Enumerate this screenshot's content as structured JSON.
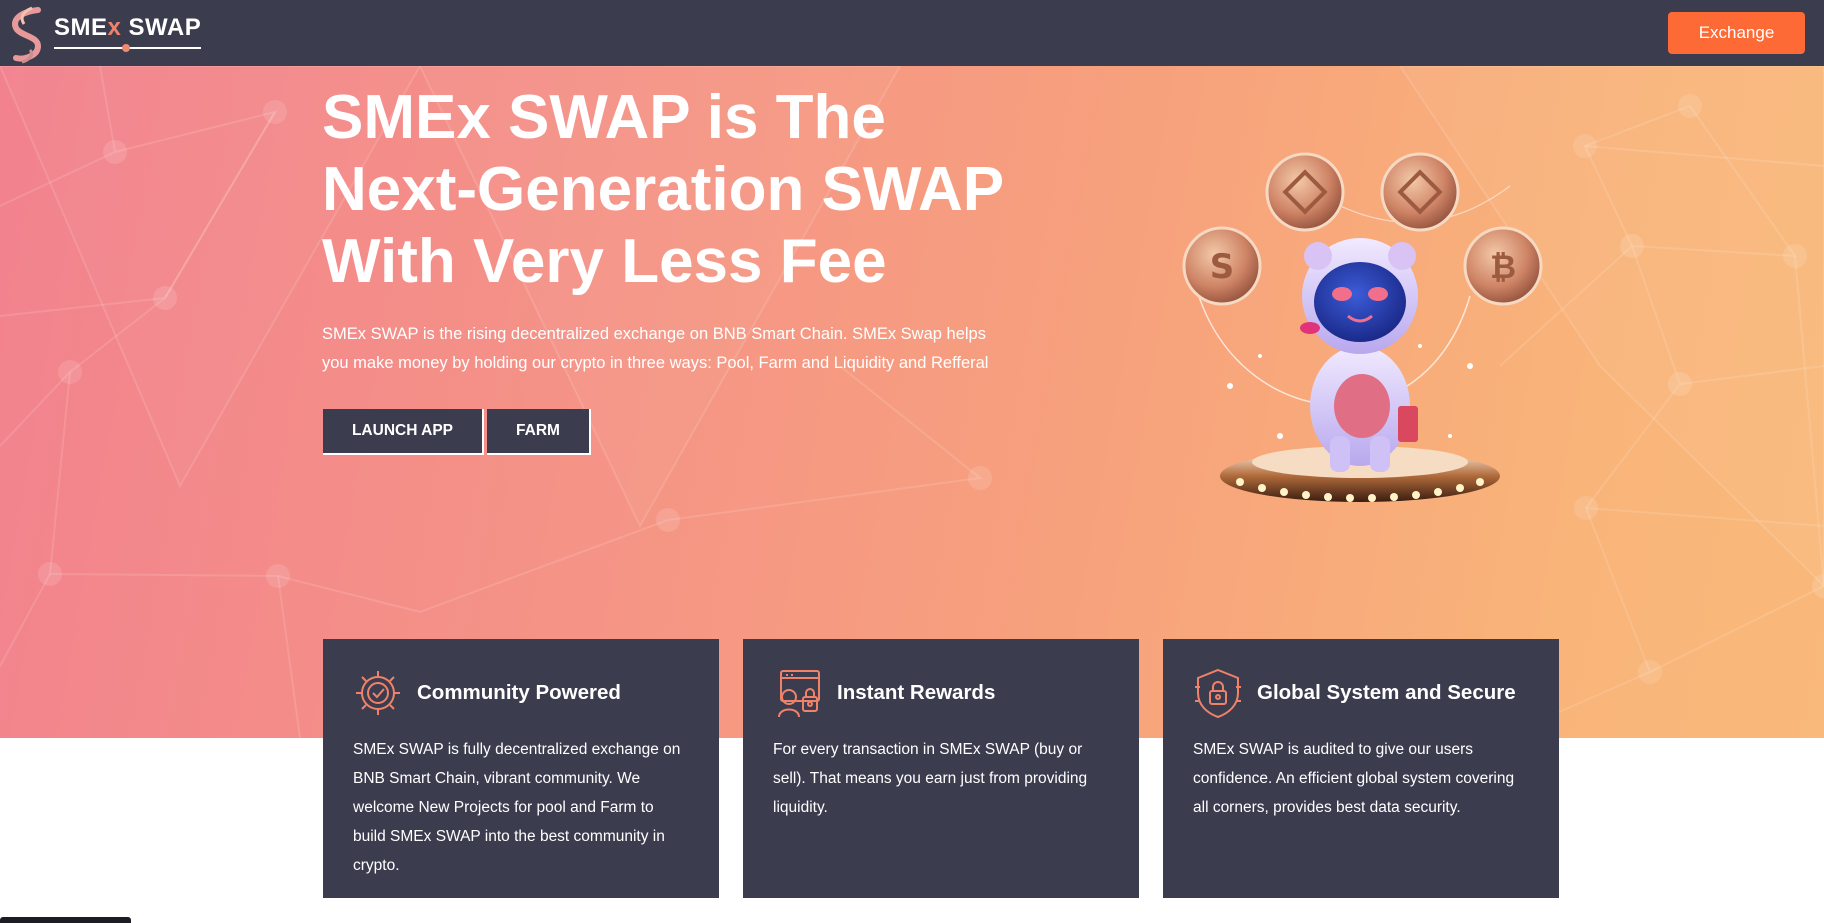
{
  "header": {
    "logo_text_1": "SME",
    "logo_text_x": "x",
    "logo_text_2": " SWAP",
    "exchange_label": "Exchange"
  },
  "hero": {
    "title": "SMEx SWAP is The Next-Generation SWAP With Very Less Fee",
    "description": "SMEx SWAP is the rising decentralized exchange on BNB Smart Chain. SMEx Swap helps you make money by holding our crypto in three ways: Pool, Farm and Liquidity and Refferal",
    "launch_label": "LAUNCH APP",
    "farm_label": "FARM"
  },
  "features": [
    {
      "icon": "gear-check-icon",
      "title": "Community Powered",
      "text": "SMEx SWAP is fully decentralized exchange on BNB Smart Chain, vibrant community. We welcome New Projects for pool and Farm to build SMEx SWAP into the best community in crypto."
    },
    {
      "icon": "rewards-icon",
      "title": "Instant Rewards",
      "text": "For every transaction in SMEx SWAP (buy or sell). That means you earn just from providing liquidity."
    },
    {
      "icon": "shield-lock-icon",
      "title": "Global System and Secure",
      "text": "SMEx SWAP is audited to give our users confidence. An efficient global system covering all corners, provides best data security."
    }
  ],
  "colors": {
    "header_bg": "#3b3c4e",
    "accent": "#fd6a35",
    "card_bg": "#3b3c4e",
    "icon_color": "#f0826a"
  }
}
